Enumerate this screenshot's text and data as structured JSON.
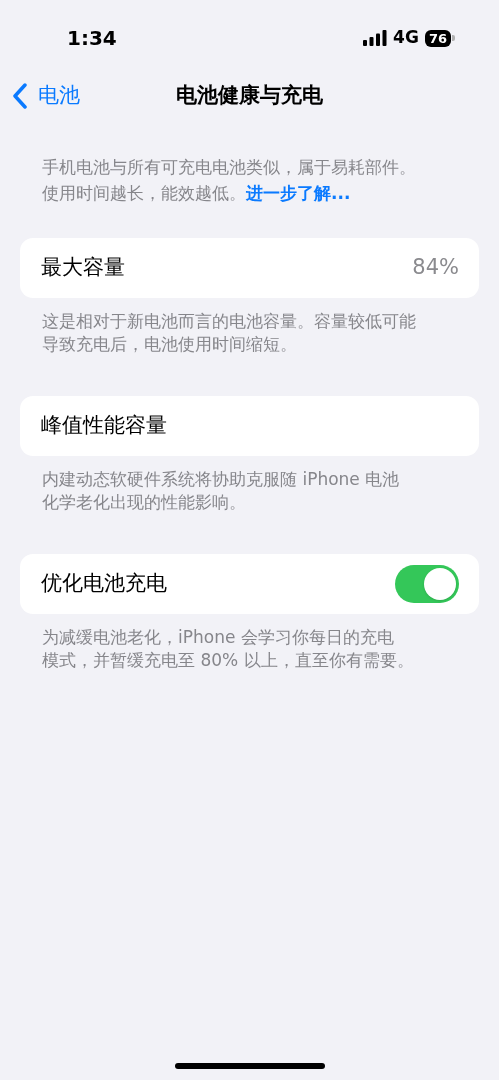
{
  "status_bar": {
    "time": "1:34",
    "network": "4G",
    "battery": "76"
  },
  "nav": {
    "back": "电池",
    "title": "电池健康与充电"
  },
  "intro": {
    "lines": [
      "手机电池与所有可充电电池类似，属于易耗部件。",
      "使用时间越长，能效越低。"
    ],
    "link": "进一步了解..."
  },
  "sections": [
    {
      "kind": "value",
      "title": "最大容量",
      "value": "84%",
      "footer": [
        "这是相对于新电池而言的电池容量。容量较低可能",
        "导致充电后，电池使用时间缩短。"
      ]
    },
    {
      "kind": "plain",
      "title": "峰值性能容量",
      "footer": [
        "内建动态软硬件系统将协助克服随 iPhone 电池",
        "化学老化出现的性能影响。"
      ]
    },
    {
      "kind": "toggle",
      "title": "优化电池充电",
      "on": true,
      "footer": [
        "为减缓电池老化，iPhone 会学习你每日的充电",
        "模式，并暂缓充电至 80% 以上，直至你有需要。"
      ]
    }
  ]
}
